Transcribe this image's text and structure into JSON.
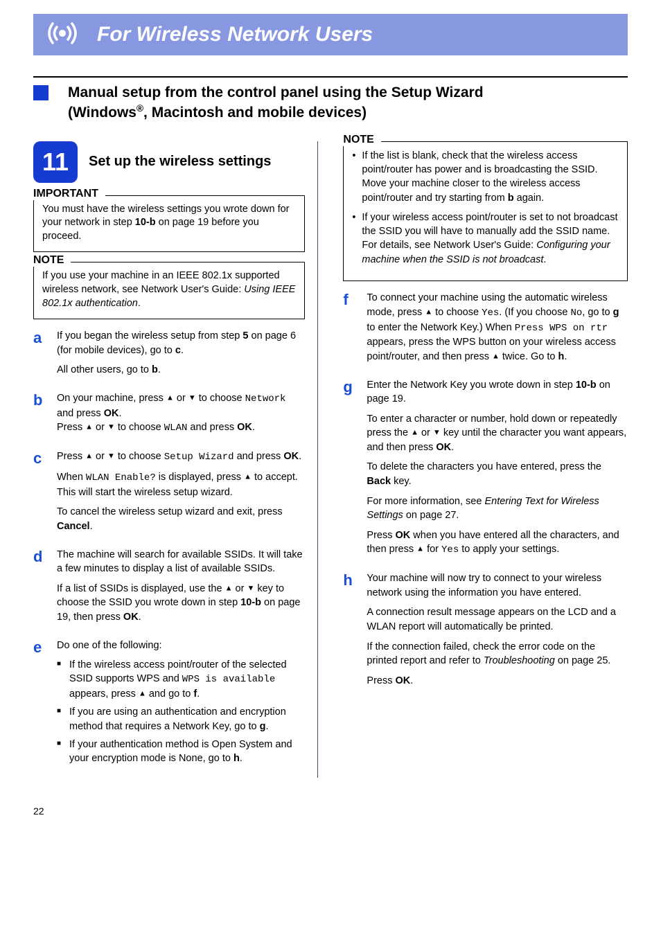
{
  "banner": {
    "title": "For Wireless Network Users"
  },
  "section": {
    "title_line1": "Manual setup from the control panel using the Setup Wizard",
    "title_line2_pre": "(Windows",
    "title_line2_sup": "®",
    "title_line2_post": ", Macintosh and mobile devices)"
  },
  "stepBlock": {
    "number": "11",
    "title": "Set up the wireless settings"
  },
  "important": {
    "label": "IMPORTANT",
    "text_pre": "You must have the wireless settings you wrote down for your network in step ",
    "ref": "10-b",
    "text_post": " on page 19 before you proceed."
  },
  "note1": {
    "label": "NOTE",
    "text_pre": "If you use your machine in an IEEE 802.1x supported wireless network, see Network User's Guide: ",
    "text_italic": "Using IEEE 802.1x authentication",
    "text_post": "."
  },
  "steps": {
    "a": {
      "p1_pre": "If you began the wireless setup from step ",
      "p1_b1": "5",
      "p1_mid": " on page 6 (for mobile devices), go to ",
      "p1_b2": "c",
      "p1_end": ".",
      "p2_pre": "All other users, go to ",
      "p2_b": "b",
      "p2_end": "."
    },
    "b": {
      "p1_pre": "On your machine, press ",
      "p1_a1": "▲",
      "p1_or": " or ",
      "p1_a2": "▼",
      "p1_mid": " to choose ",
      "p1_mono": "Network",
      "p1_mid2": " and press ",
      "p1_ok": "OK",
      "p1_end": ".",
      "p2_pre": "Press ",
      "p2_a1": "▲",
      "p2_or": " or ",
      "p2_a2": "▼",
      "p2_mid": " to choose ",
      "p2_mono": "WLAN",
      "p2_mid2": " and press ",
      "p2_ok": "OK",
      "p2_end": "."
    },
    "c": {
      "p1_pre": "Press ",
      "p1_a1": "▲",
      "p1_or": " or ",
      "p1_a2": "▼",
      "p1_mid": " to choose ",
      "p1_mono": "Setup Wizard",
      "p1_mid2": " and press ",
      "p1_ok": "OK",
      "p1_end": ".",
      "p2_pre": "When ",
      "p2_mono": "WLAN Enable?",
      "p2_mid": " is displayed, press ",
      "p2_a": "▲",
      "p2_end": " to accept. This will start the wireless setup wizard.",
      "p3_pre": "To cancel the wireless setup wizard and exit, press ",
      "p3_b": "Cancel",
      "p3_end": "."
    },
    "d": {
      "p1": "The machine will search for available SSIDs. It will take a few minutes to display a list of available SSIDs.",
      "p2_pre": "If a list of SSIDs is displayed, use the ",
      "p2_a1": "▲",
      "p2_or": " or ",
      "p2_a2": "▼",
      "p2_mid": " key to choose the SSID you wrote down in step ",
      "p2_ref": "10-b",
      "p2_mid2": " on page 19, then press ",
      "p2_ok": "OK",
      "p2_end": "."
    },
    "e": {
      "p1": "Do one of the following:",
      "li1_pre": "If the wireless access point/router of the selected SSID supports WPS and ",
      "li1_mono": "WPS is available",
      "li1_mid": " appears, press ",
      "li1_a": "▲",
      "li1_mid2": " and go to ",
      "li1_b": "f",
      "li1_end": ".",
      "li2_pre": "If you are using an authentication and encryption method that requires a Network Key, go to ",
      "li2_b": "g",
      "li2_end": ".",
      "li3_pre": "If your authentication method is Open System and your encryption mode is None, go to ",
      "li3_b": "h",
      "li3_end": "."
    },
    "f": {
      "p1_pre": "To connect your machine using the automatic wireless mode, press ",
      "p1_a": "▲",
      "p1_mid": " to choose ",
      "p1_mono1": "Yes",
      "p1_mid2": ". (If you choose ",
      "p1_mono2": "No",
      "p1_mid3": ", go to ",
      "p1_b": "g",
      "p1_mid4": " to enter the Network Key.) When ",
      "p1_mono3": "Press WPS on rtr",
      "p1_mid5": " appears, press the WPS button on your wireless access point/router, and then press ",
      "p1_a2": "▲",
      "p1_mid6": " twice. Go to ",
      "p1_b2": "h",
      "p1_end": "."
    },
    "g": {
      "p1_pre": "Enter the Network Key you wrote down in step ",
      "p1_ref": "10-b",
      "p1_end": " on page 19.",
      "p2_pre": "To enter a character or number, hold down or repeatedly press the ",
      "p2_a1": "▲",
      "p2_or": " or ",
      "p2_a2": "▼",
      "p2_mid": " key until the character you want appears, and then press ",
      "p2_ok": "OK",
      "p2_end": ".",
      "p3_pre": "To delete the characters you have entered, press the ",
      "p3_b": "Back",
      "p3_end": " key.",
      "p4_pre": "For more information, see ",
      "p4_i": "Entering Text for Wireless Settings",
      "p4_end": " on page 27.",
      "p5_pre": "Press ",
      "p5_ok": "OK",
      "p5_mid": " when you have entered all the characters, and then press ",
      "p5_a": "▲",
      "p5_mid2": " for ",
      "p5_mono": "Yes",
      "p5_end": " to apply your settings."
    },
    "h": {
      "p1": "Your machine will now try to connect to your wireless network using the information you have entered.",
      "p2": "A connection result message appears on the LCD and a WLAN report will automatically be printed.",
      "p3_pre": "If the connection failed, check the error code on the printed report and refer to ",
      "p3_i": "Troubleshooting",
      "p3_end": " on page 25.",
      "p4_pre": "Press ",
      "p4_ok": "OK",
      "p4_end": "."
    }
  },
  "note2": {
    "label": "NOTE",
    "li1_pre": "If the list is blank, check that the wireless access point/router has power and is broadcasting the SSID. Move your machine closer to the wireless access point/router and try starting from ",
    "li1_b": "b",
    "li1_end": " again.",
    "li2_pre": "If your wireless access point/router is set to not broadcast the SSID you will have to manually add the SSID name. For details, see Network User's Guide: ",
    "li2_i": "Configuring your machine when the SSID is not broadcast",
    "li2_end": "."
  },
  "pageNumber": "22"
}
